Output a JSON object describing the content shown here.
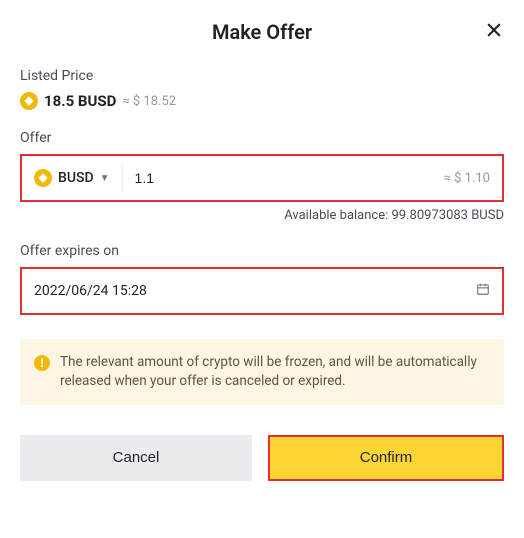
{
  "header": {
    "title": "Make Offer"
  },
  "listed": {
    "label": "Listed Price",
    "amount": "18.5 BUSD",
    "approx": "≈ $ 18.52"
  },
  "offer": {
    "label": "Offer",
    "currency": "BUSD",
    "amount": "1.1",
    "approx": "≈ $ 1.10",
    "balance": "Available balance: 99.80973083 BUSD"
  },
  "expiry": {
    "label": "Offer expires on",
    "value": "2022/06/24 15:28"
  },
  "notice": {
    "text": "The relevant amount of crypto will be frozen, and will be automatically released when your offer is canceled or expired."
  },
  "buttons": {
    "cancel": "Cancel",
    "confirm": "Confirm"
  }
}
